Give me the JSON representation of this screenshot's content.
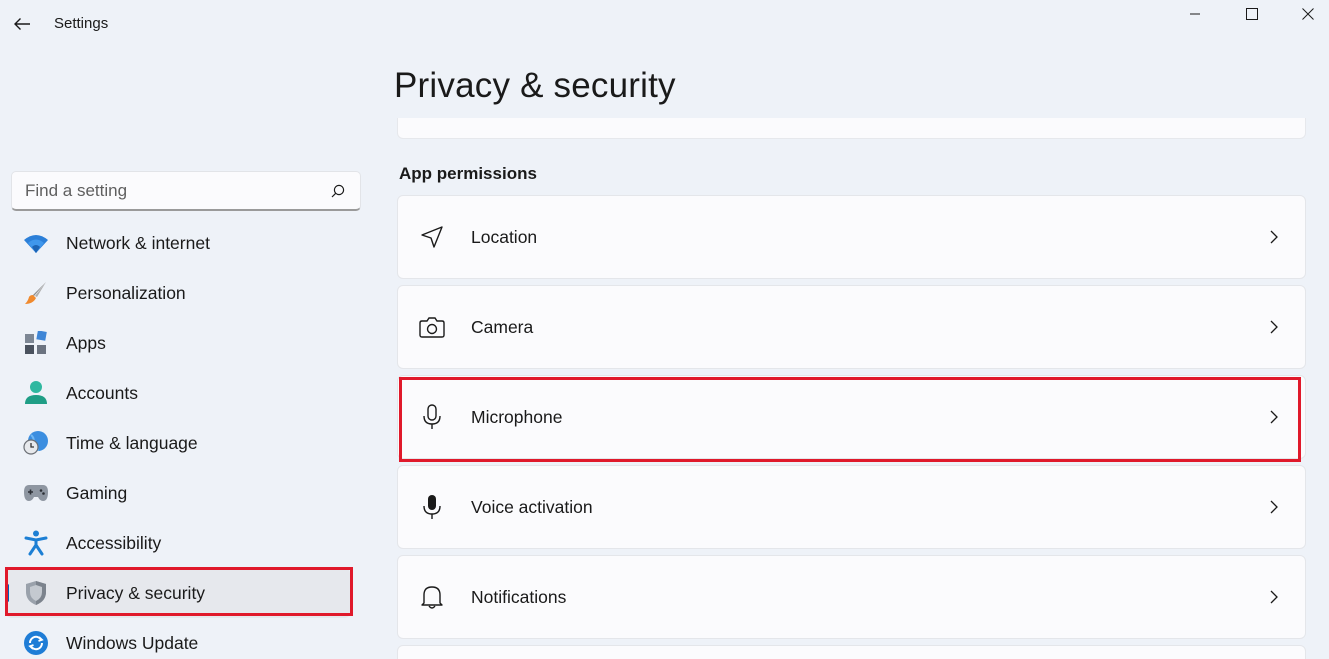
{
  "window": {
    "title": "Settings"
  },
  "search": {
    "placeholder": "Find a setting"
  },
  "sidebar": {
    "items": [
      {
        "label": "Network & internet",
        "icon": "wifi-icon"
      },
      {
        "label": "Personalization",
        "icon": "paintbrush-icon"
      },
      {
        "label": "Apps",
        "icon": "apps-icon"
      },
      {
        "label": "Accounts",
        "icon": "person-icon"
      },
      {
        "label": "Time & language",
        "icon": "globe-clock-icon"
      },
      {
        "label": "Gaming",
        "icon": "gamepad-icon"
      },
      {
        "label": "Accessibility",
        "icon": "accessibility-icon"
      },
      {
        "label": "Privacy & security",
        "icon": "shield-icon",
        "active": true
      },
      {
        "label": "Windows Update",
        "icon": "update-icon"
      }
    ]
  },
  "main": {
    "title": "Privacy & security",
    "section_label": "App permissions",
    "permissions": [
      {
        "label": "Location",
        "icon": "location-icon"
      },
      {
        "label": "Camera",
        "icon": "camera-icon"
      },
      {
        "label": "Microphone",
        "icon": "microphone-icon"
      },
      {
        "label": "Voice activation",
        "icon": "microphone-filled-icon"
      },
      {
        "label": "Notifications",
        "icon": "bell-icon"
      }
    ]
  },
  "colors": {
    "accent": "#005fb8",
    "highlight": "#e0192b",
    "background": "#eef2f8"
  }
}
